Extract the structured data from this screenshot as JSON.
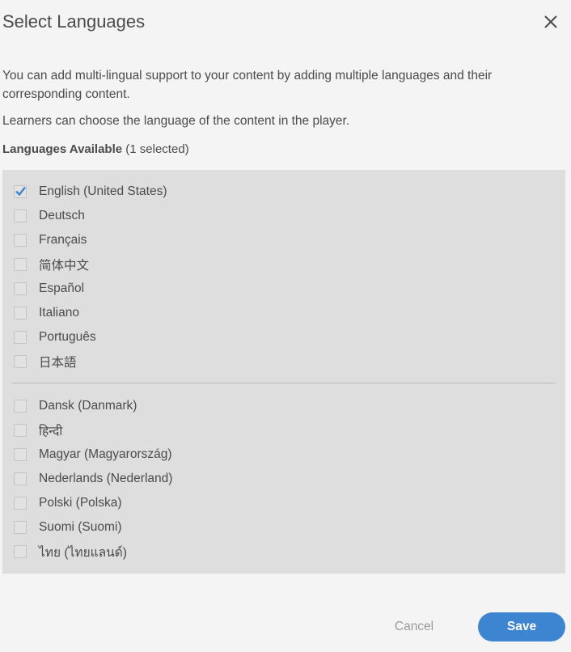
{
  "dialog": {
    "title": "Select Languages",
    "description": "You can add multi-lingual support to your content by adding multiple languages and their corresponding content.",
    "description2": "Learners can choose the language of the content in the player.",
    "available_label": "Languages Available",
    "selected_count": "(1 selected)"
  },
  "languages_primary": [
    {
      "label": "English (United States)",
      "checked": true
    },
    {
      "label": "Deutsch",
      "checked": false
    },
    {
      "label": "Français",
      "checked": false
    },
    {
      "label": "简体中文",
      "checked": false
    },
    {
      "label": "Español",
      "checked": false
    },
    {
      "label": "Italiano",
      "checked": false
    },
    {
      "label": "Português",
      "checked": false
    },
    {
      "label": "日本語",
      "checked": false
    }
  ],
  "languages_secondary": [
    {
      "label": "Dansk (Danmark)",
      "checked": false
    },
    {
      "label": "हिन्दी",
      "checked": false
    },
    {
      "label": "Magyar (Magyarország)",
      "checked": false
    },
    {
      "label": "Nederlands (Nederland)",
      "checked": false
    },
    {
      "label": "Polski (Polska)",
      "checked": false
    },
    {
      "label": "Suomi (Suomi)",
      "checked": false
    },
    {
      "label": "ไทย (ไทยแลนด์)",
      "checked": false
    }
  ],
  "footer": {
    "cancel_label": "Cancel",
    "save_label": "Save"
  },
  "colors": {
    "accent": "#3d84d1",
    "check": "#3d84d1"
  }
}
